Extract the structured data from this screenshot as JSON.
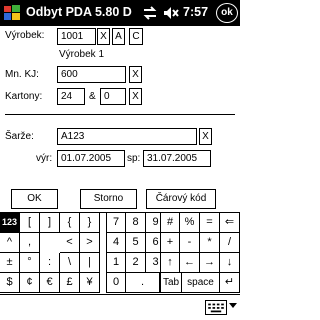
{
  "titlebar": {
    "title": "Odbyt PDA 5.80 D",
    "time": "7:57",
    "ok_label": "ok"
  },
  "form": {
    "vyrobek_label": "Výrobek:",
    "vyrobek_value": "1001",
    "vyrobek_name": "Výrobek 1",
    "btn_x": "X",
    "btn_a": "A",
    "btn_c": "C",
    "mnkj_label": "Mn. KJ:",
    "mnkj_value": "600",
    "kartony_label": "Kartony:",
    "kartony_value1": "24",
    "kartony_amp": "&",
    "kartony_value2": "0",
    "sarze_label": "Šarže:",
    "sarze_value": "A123",
    "vyr_label": "výr:",
    "vyr_value": "01.07.2005",
    "sp_label": "sp:",
    "sp_value": "31.07.2005"
  },
  "buttons": {
    "ok": "OK",
    "storno": "Storno",
    "barcode": "Čárový kód"
  },
  "keyboard": {
    "rows": [
      [
        "123",
        "[",
        "]",
        "{",
        "}",
        "7",
        "8",
        "9",
        "#",
        "%",
        "=",
        "⇐"
      ],
      [
        "^",
        ",",
        "<",
        ">",
        "4",
        "5",
        "6",
        "+",
        "-",
        "*",
        "/"
      ],
      [
        "±",
        "°",
        ":",
        "\\",
        "|",
        "1",
        "2",
        "3",
        "↑",
        "←",
        "→",
        "↓"
      ],
      [
        "$",
        "¢",
        "€",
        "£",
        "¥",
        "0",
        ".",
        "Tab",
        "space",
        "↵"
      ]
    ]
  }
}
